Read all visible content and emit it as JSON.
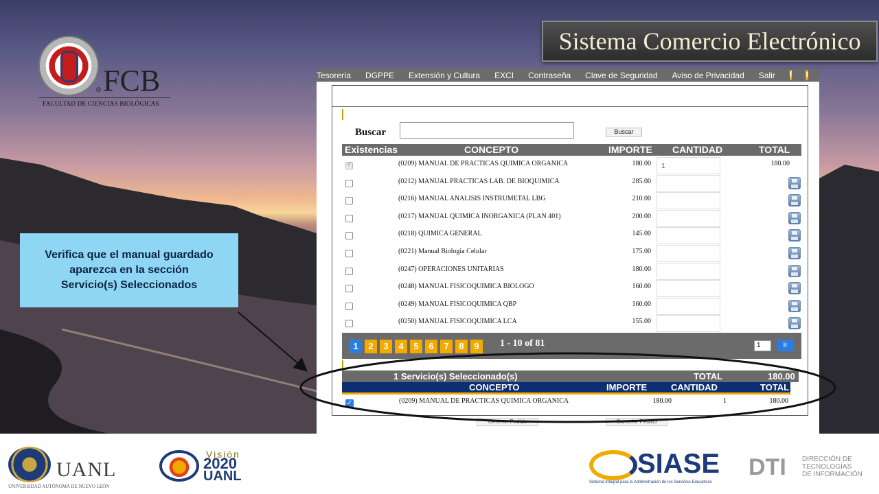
{
  "slide": {
    "title": "Sistema Comercio Electrónico",
    "callout": [
      "Verifica que el manual guardado",
      "aparezca en la sección",
      "Servicio(s) Seleccionados"
    ]
  },
  "fcb": {
    "name": "FCB",
    "reg": "®",
    "subtitle": "FACULTAD DE CIENCIAS BIOLÓGICAS"
  },
  "nav": {
    "items": [
      "Tesorería",
      "DGPPE",
      "Extensión y Cultura",
      "EXCI",
      "Contraseña",
      "Clave de Seguridad",
      "Aviso de Privacidad",
      "Salir"
    ],
    "social": [
      {
        "icon": "facebook-icon",
        "glyph": "f"
      },
      {
        "icon": "twitter-icon",
        "glyph": "t"
      }
    ]
  },
  "search": {
    "label": "Buscar",
    "value": "",
    "button": "Buscar"
  },
  "table": {
    "headers": {
      "existencias": "Existencias",
      "concepto": "CONCEPTO",
      "importe": "IMPORTE",
      "cantidad": "CANTIDAD",
      "total": "TOTAL"
    },
    "rows": [
      {
        "checked": true,
        "concepto": "(0209) MANUAL DE PRACTICAS QUIMICA ORGANICA",
        "importe": "180.00",
        "cantidad": "1",
        "total": "180.00",
        "save": false
      },
      {
        "checked": false,
        "concepto": "(0212) MANUAL PRACTICAS LAB. DE BIOQUIMICA",
        "importe": "285.00",
        "cantidad": "",
        "total": "",
        "save": true
      },
      {
        "checked": false,
        "concepto": "(0216) MANUAL ANALISIS INSTRUMETAL LBG",
        "importe": "210.00",
        "cantidad": "",
        "total": "",
        "save": true
      },
      {
        "checked": false,
        "concepto": "(0217) MANUAL QUIMICA INORGANICA (PLAN 401)",
        "importe": "200.00",
        "cantidad": "",
        "total": "",
        "save": true
      },
      {
        "checked": false,
        "concepto": "(0218) QUIMICA GENERAL",
        "importe": "145.00",
        "cantidad": "",
        "total": "",
        "save": true
      },
      {
        "checked": false,
        "concepto": "(0221) Manual Biologia Celular",
        "importe": "175.00",
        "cantidad": "",
        "total": "",
        "save": true
      },
      {
        "checked": false,
        "concepto": "(0247) OPERACIONES UNITARIAS",
        "importe": "180.00",
        "cantidad": "",
        "total": "",
        "save": true
      },
      {
        "checked": false,
        "concepto": "(0248) MANUAL FISICOQUIMICA BIOLOGO",
        "importe": "160.00",
        "cantidad": "",
        "total": "",
        "save": true
      },
      {
        "checked": false,
        "concepto": "(0249) MANUAL FISICOQUIMICA QBP",
        "importe": "160.00",
        "cantidad": "",
        "total": "",
        "save": true
      },
      {
        "checked": false,
        "concepto": "(0250) MANUAL FISICOQUIMICA LCA",
        "importe": "155.00",
        "cantidad": "",
        "total": "",
        "save": true
      }
    ]
  },
  "pager": {
    "pages": [
      "1",
      "2",
      "3",
      "4",
      "5",
      "6",
      "7",
      "8",
      "9"
    ],
    "active": "1",
    "range": "1 - 10 of 81",
    "goto_value": "1",
    "goto_button": "Ir"
  },
  "selected": {
    "heading": "1 Servicio(s) Seleccionado(s)",
    "total_label": "TOTAL",
    "total_value": "180.00",
    "headers": {
      "concepto": "CONCEPTO",
      "importe": "IMPORTE",
      "cantidad": "CANTIDAD",
      "total": "TOTAL"
    },
    "row": {
      "checked": true,
      "concepto": "(0209) MANUAL DE PRACTICAS QUIMICA ORGANICA",
      "importe": "180.00",
      "cantidad": "1",
      "total": "180.00"
    }
  },
  "footer_buttons": [
    "Generar Pedido",
    "Cancelar Pedido"
  ],
  "footer": {
    "uanl": "UANL",
    "uanl_sub": "UNIVERSIDAD AUTÓNOMA DE NUEVO LEÓN",
    "vision_word": "Visión",
    "vision_num": "2020",
    "vision_uanl": "UANL",
    "siase": "SIASE",
    "siase_sub": "Sistema Integral para la Administración de los Servicios Educativos",
    "dti": "DTI",
    "dti_sub": [
      "DIRECCIÓN DE",
      "TECNOLOGÍAS",
      "DE INFORMACIÓN"
    ]
  },
  "colors": {
    "nav_gray": "#6b6b6b",
    "accent_orange": "#f2a900",
    "accent_blue": "#2a7de1",
    "navy": "#0c2f74",
    "callout_bg": "#8fd6f5"
  }
}
